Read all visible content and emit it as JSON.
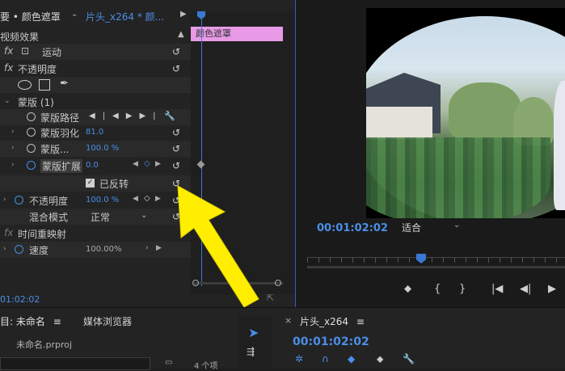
{
  "effect_controls": {
    "tab_prefix": "要 •",
    "source_title": "颜色遮罩",
    "clip_title": "片头_x264 * 颜...",
    "clip_bar_label": "颜色遮罩",
    "section_title": "视频效果",
    "rows": {
      "motion": "运动",
      "opacity_top": "不透明度",
      "mask_group": "蒙版 (1)",
      "mask_path": "蒙版路径",
      "mask_feather": "蒙版羽化",
      "mask_feather_value": "81.0",
      "mask_opacity": "蒙版...",
      "mask_opacity_value": "100.0 %",
      "mask_expansion": "蒙版扩展",
      "mask_expansion_value": "0.0",
      "inverted": "已反转",
      "opacity": "不透明度",
      "opacity_value": "100.0 %",
      "blend_mode": "混合模式",
      "blend_value": "正常",
      "time_remap": "时间重映射",
      "speed": "速度",
      "speed_value": "100.00%"
    },
    "timecode": "01:02:02"
  },
  "program_monitor": {
    "timecode": "00:01:02:02",
    "fit_label": "适合"
  },
  "project_panel": {
    "tab_label": "目: 未命名",
    "menu_icon": "≡",
    "media_browser_tab": "媒体浏览器",
    "file_name": "未命名.prproj",
    "items_count": "4 个项"
  },
  "sequence_panel": {
    "tab_label": "片头_x264",
    "timecode": "00:01:02:02"
  },
  "colors": {
    "accent": "#4a8ee8",
    "clip": "#e89ae6",
    "arrow": "#ffee00"
  }
}
